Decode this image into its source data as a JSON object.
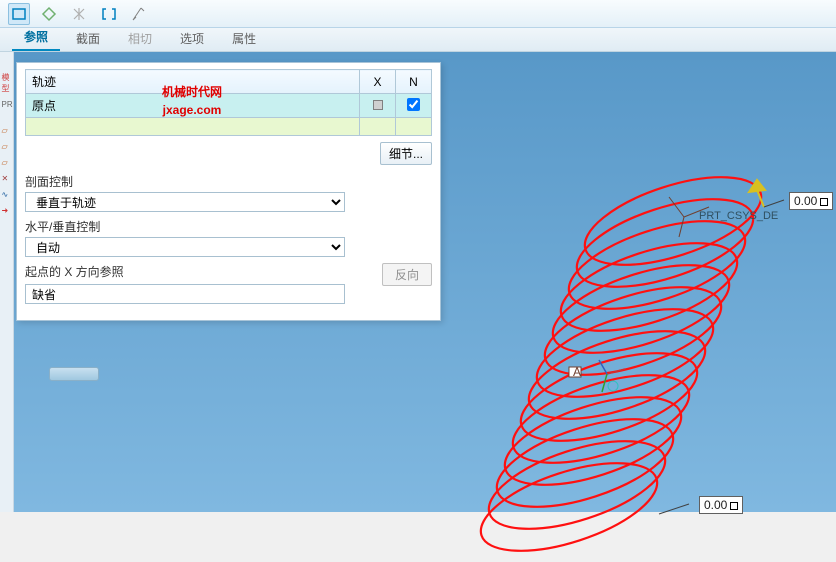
{
  "toolbar": {
    "icons": [
      "rect-icon",
      "diamond-icon",
      "strike-icon",
      "bracket-icon",
      "measure-icon"
    ]
  },
  "tabs": {
    "items": [
      {
        "label": "参照",
        "state": "active"
      },
      {
        "label": "截面",
        "state": ""
      },
      {
        "label": "相切",
        "state": "disabled"
      },
      {
        "label": "选项",
        "state": ""
      },
      {
        "label": "属性",
        "state": ""
      }
    ]
  },
  "panel": {
    "traj_header": "轨迹",
    "col_x": "X",
    "col_n": "N",
    "row_origin": "原点",
    "n_checked": true,
    "detail_btn": "细节...",
    "section_ctrl_label": "剖面控制",
    "section_ctrl_value": "垂直于轨迹",
    "horiz_vert_label": "水平/垂直控制",
    "horiz_vert_value": "自动",
    "start_dir_label": "起点的 X 方向参照",
    "start_dir_value": "缺省",
    "reverse_btn": "反向"
  },
  "watermark": {
    "line1": "机械时代网",
    "line2": "jxage.com"
  },
  "viewport": {
    "csys_label": "PRT_CSYS_DE",
    "dim_top": "0.00",
    "dim_bottom": "0.00",
    "datum_a": "A"
  }
}
